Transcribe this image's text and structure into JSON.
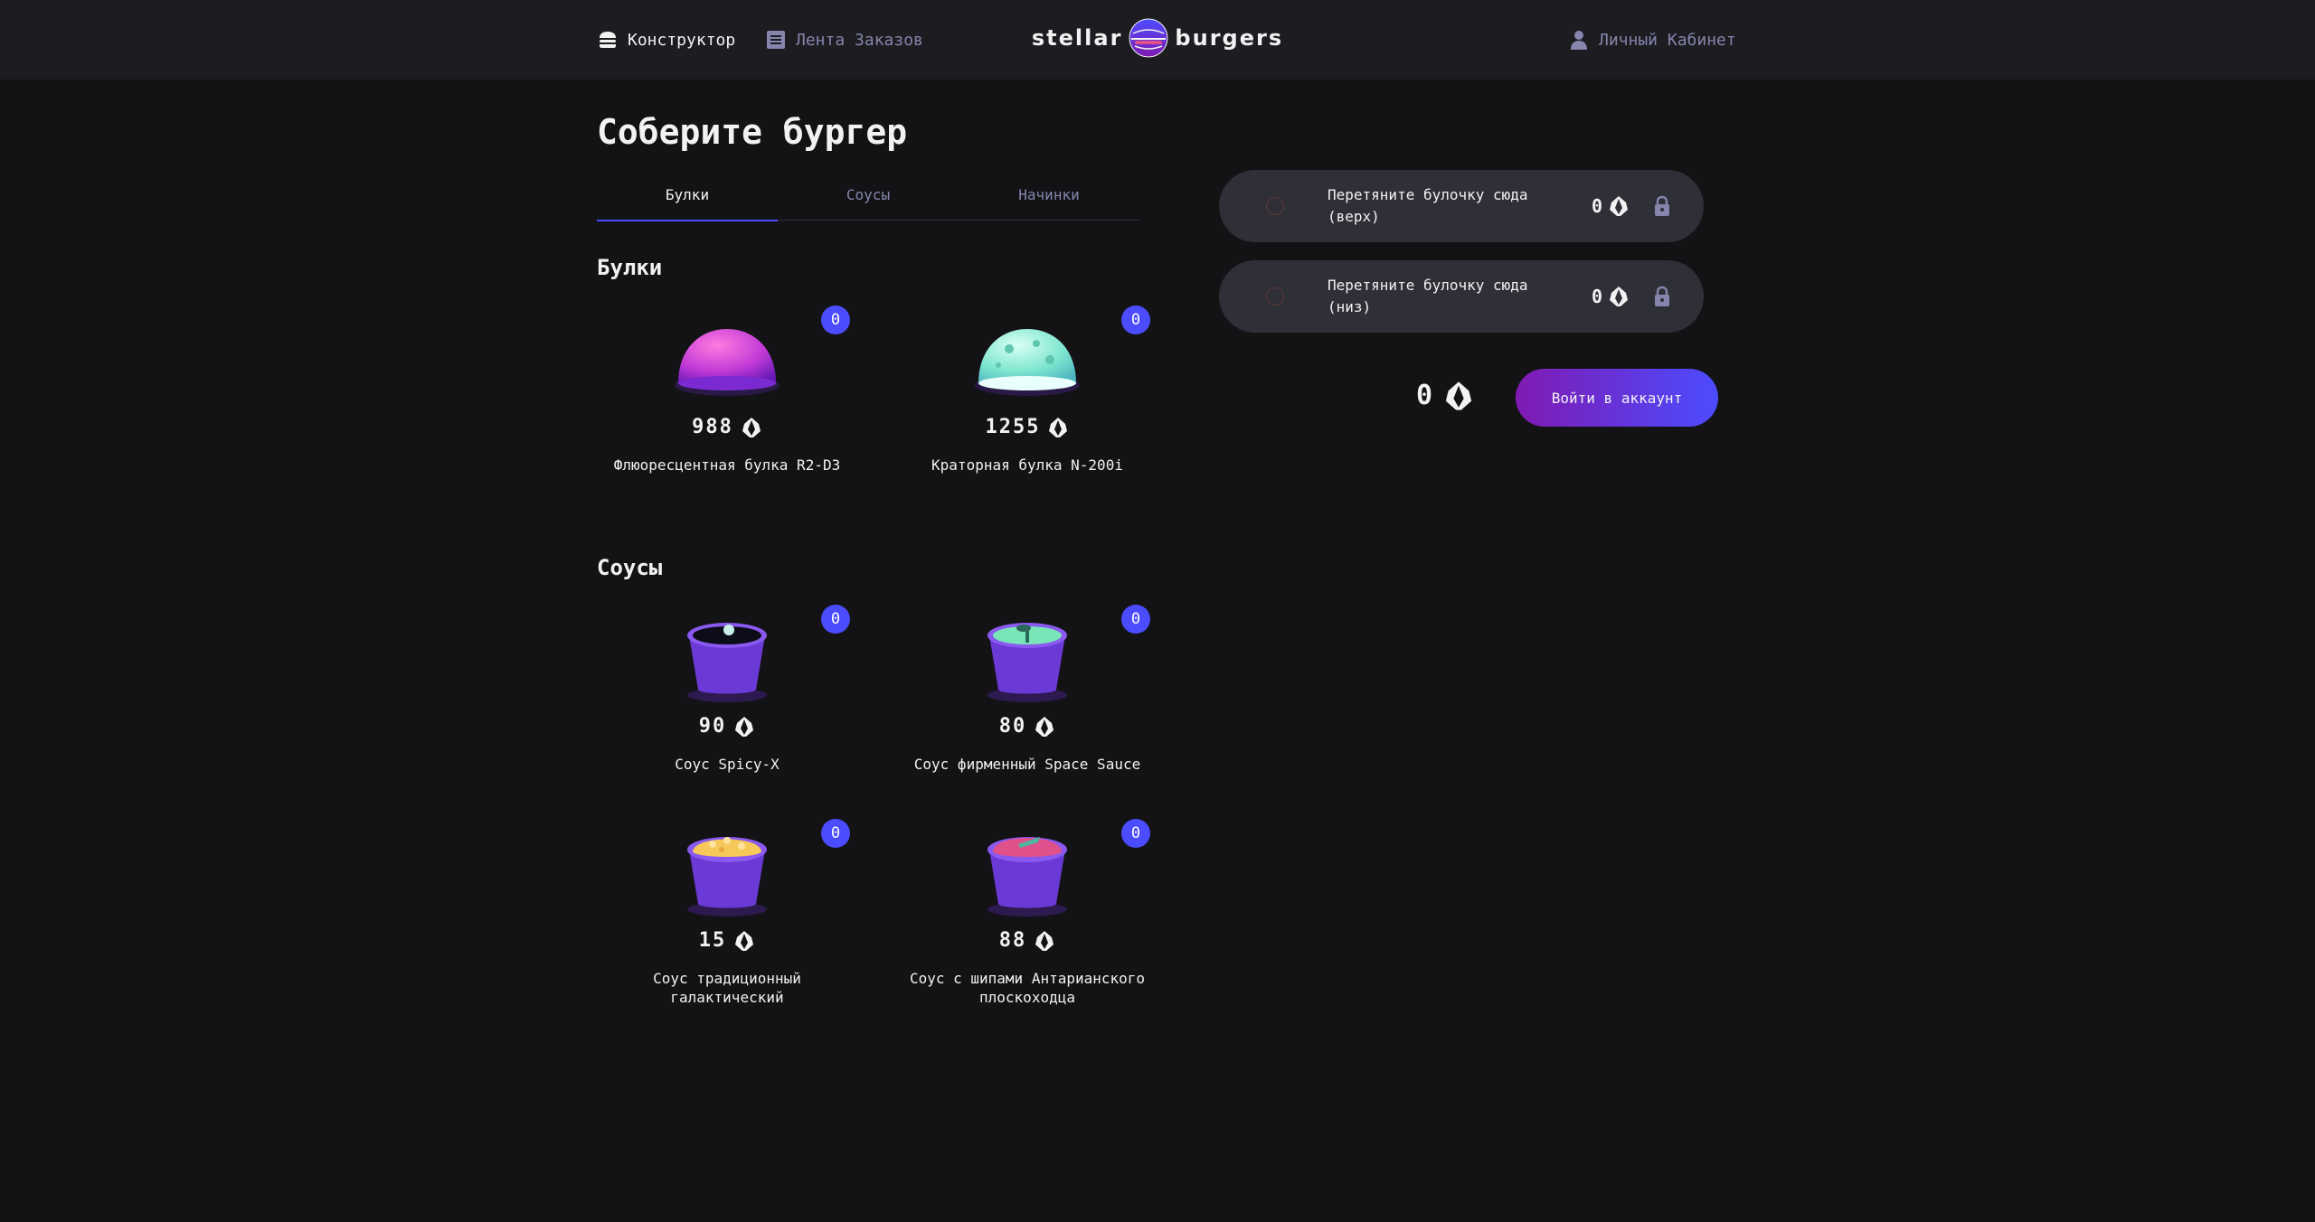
{
  "header": {
    "nav_constructor": "Конструктор",
    "nav_feed": "Лента Заказов",
    "logo_left": "stellar",
    "logo_right": "burgers",
    "nav_account": "Личный Кабинет"
  },
  "main": {
    "title": "Соберите бургер",
    "tabs": [
      {
        "label": "Булки",
        "active": true
      },
      {
        "label": "Соусы",
        "active": false
      },
      {
        "label": "Начинки",
        "active": false
      }
    ],
    "sections": {
      "buns_title": "Булки",
      "sauces_title": "Соусы"
    },
    "buns": [
      {
        "name": "Флюоресцентная булка R2-D3",
        "price": "988",
        "count": "0",
        "image": "purple-bun"
      },
      {
        "name": "Краторная булка N-200i",
        "price": "1255",
        "count": "0",
        "image": "crater-bun"
      }
    ],
    "sauces": [
      {
        "name": "Соус Spicy-X",
        "price": "90",
        "count": "0",
        "image": "sauce-dark"
      },
      {
        "name": "Соус фирменный Space Sauce",
        "price": "80",
        "count": "0",
        "image": "sauce-green"
      },
      {
        "name": "Соус традиционный галактический",
        "price": "15",
        "count": "0",
        "image": "sauce-yellow"
      },
      {
        "name": "Соус с шипами Антарианского плоскоходца",
        "price": "88",
        "count": "0",
        "image": "sauce-pink"
      }
    ]
  },
  "constructor": {
    "top_slot": {
      "text": "Перетяните булочку сюда (верх)",
      "price": "0"
    },
    "bottom_slot": {
      "text": "Перетяните булочку сюда (низ)",
      "price": "0"
    },
    "total": "0",
    "login_button": "Войти в аккаунт"
  },
  "icons": {
    "currency": "currency-icon",
    "lock": "lock-icon",
    "burger": "burger-icon",
    "list": "list-icon",
    "profile": "profile-icon"
  },
  "colors": {
    "background": "#131316",
    "header": "#1c1c21",
    "accent": "#4c4cff",
    "muted_text": "#8585ad",
    "slot_bg": "#2f2f37",
    "button_gradient_start": "#801ab2",
    "button_gradient_end": "#4c4cff"
  }
}
